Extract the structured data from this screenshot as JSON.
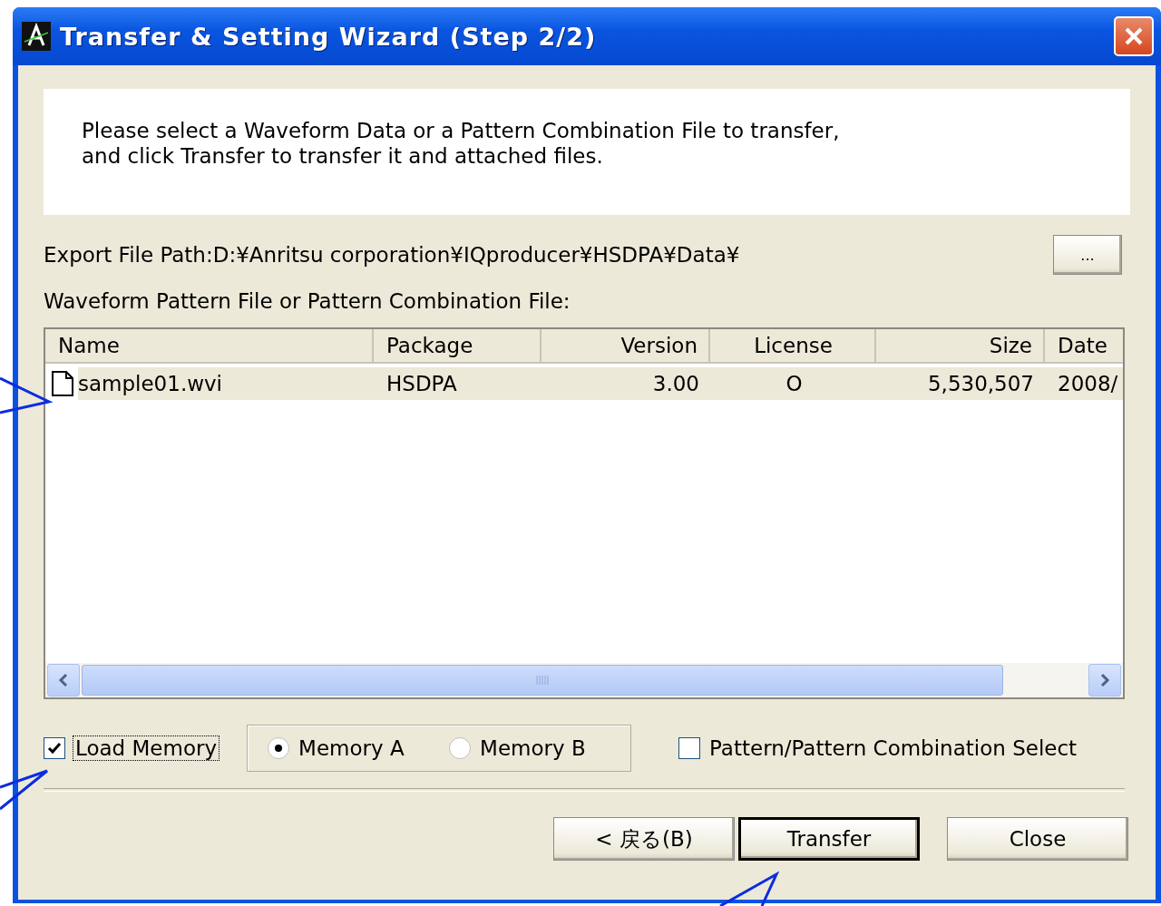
{
  "window": {
    "title": "Transfer & Setting Wizard (Step 2/2)"
  },
  "instructions": [
    "Please select a Waveform Data or a Pattern Combination File to transfer,",
    "and click Transfer to transfer it and attached files."
  ],
  "export_path": {
    "label": "Export File Path:D:¥Anritsu corporation¥IQproducer¥HSDPA¥Data¥",
    "browse_button": "..."
  },
  "list_label": "Waveform Pattern File or Pattern Combination File:",
  "table": {
    "columns": [
      {
        "label": "Name"
      },
      {
        "label": "Package"
      },
      {
        "label": "Version"
      },
      {
        "label": "License"
      },
      {
        "label": "Size"
      },
      {
        "label": "Date"
      }
    ],
    "rows": [
      {
        "selected": true,
        "cells": [
          "sample01.wvi",
          "HSDPA",
          "3.00",
          "O",
          "5,530,507",
          "2008/"
        ]
      }
    ]
  },
  "load_memory": {
    "label": "Load Memory",
    "checked": true
  },
  "memory_options": [
    {
      "label": "Memory A",
      "selected": true
    },
    {
      "label": "Memory B",
      "selected": false
    }
  ],
  "pattern_select": {
    "label": "Pattern/Pattern Combination Select",
    "checked": false
  },
  "buttons": [
    {
      "label": "< 戻る(B)",
      "default": false
    },
    {
      "label": "Transfer",
      "default": true
    },
    {
      "label": "Close",
      "default": false
    }
  ]
}
